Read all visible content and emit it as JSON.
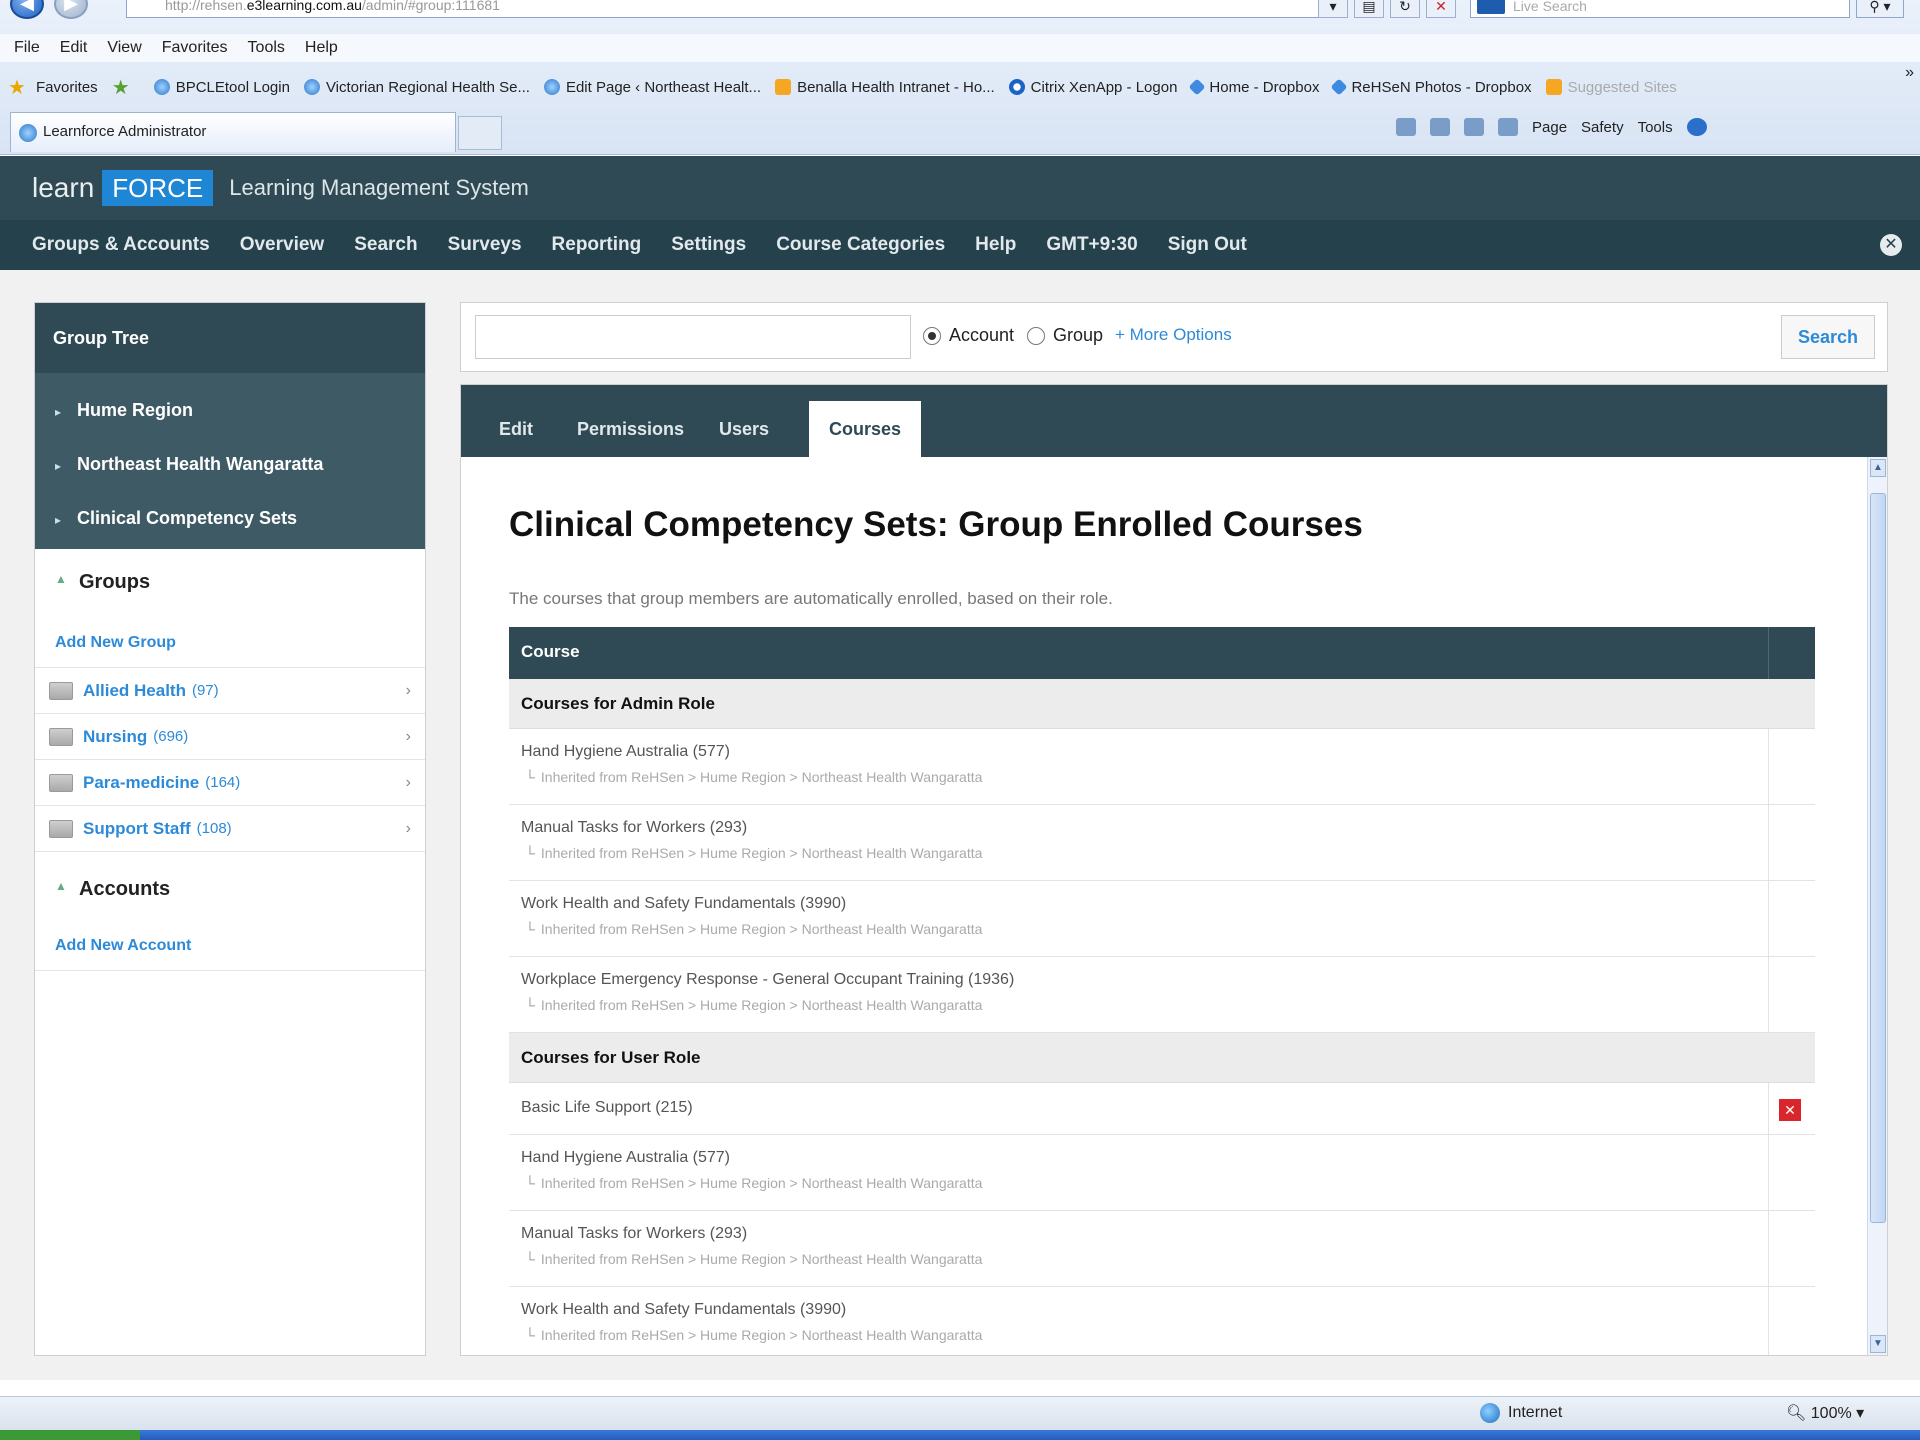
{
  "browser": {
    "url_prefix": "http://rehsen.",
    "url_domain": "e3learning.com.au",
    "url_path": "/admin/#group:111681",
    "live_search_placeholder": "Live Search",
    "menu": [
      "File",
      "Edit",
      "View",
      "Favorites",
      "Tools",
      "Help"
    ],
    "favorites_label": "Favorites",
    "favorites": [
      {
        "label": "BPCLEtool Login",
        "icon": "ie-icon"
      },
      {
        "label": "Victorian Regional Health Se...",
        "icon": "ie-icon"
      },
      {
        "label": "Edit Page ‹ Northeast Healt...",
        "icon": "ie-icon"
      },
      {
        "label": "Benalla Health Intranet - Ho...",
        "icon": "orange-icon"
      },
      {
        "label": "Citrix XenApp - Logon",
        "icon": "citrix-icon"
      },
      {
        "label": "Home - Dropbox",
        "icon": "dropbox-icon"
      },
      {
        "label": "ReHSeN Photos - Dropbox",
        "icon": "dropbox-icon"
      },
      {
        "label": "Suggested Sites",
        "icon": "orange-icon"
      }
    ],
    "tab_title": "Learnforce Administrator",
    "command_bar": [
      "Page",
      "Safety",
      "Tools"
    ],
    "status_zone": "Internet",
    "zoom": "100%"
  },
  "app": {
    "logo_learn": "learn",
    "logo_force": "FORCE",
    "logo_subtitle": "Learning Management System",
    "nav": [
      "Groups & Accounts",
      "Overview",
      "Search",
      "Surveys",
      "Reporting",
      "Settings",
      "Course Categories",
      "Help",
      "GMT+9:30",
      "Sign Out"
    ]
  },
  "sidebar": {
    "title": "Group Tree",
    "tree": [
      "Hume Region",
      "Northeast Health Wangaratta",
      "Clinical Competency Sets"
    ],
    "groups_heading": "Groups",
    "add_group": "Add New Group",
    "groups": [
      {
        "name": "Allied Health",
        "count": "(97)"
      },
      {
        "name": "Nursing",
        "count": "(696)"
      },
      {
        "name": "Para-medicine",
        "count": "(164)"
      },
      {
        "name": "Support Staff",
        "count": "(108)"
      }
    ],
    "accounts_heading": "Accounts",
    "add_account": "Add New Account"
  },
  "search": {
    "radio_account": "Account",
    "radio_group": "Group",
    "more_options": "+ More Options",
    "button": "Search"
  },
  "tabs": [
    "Edit",
    "Permissions",
    "Users",
    "Courses"
  ],
  "main": {
    "title": "Clinical Competency Sets: Group Enrolled Courses",
    "description": "The courses that group members are automatically enrolled, based on their role.",
    "column_header": "Course",
    "inherited_text": "Inherited from ReHSen > Hume Region > Northeast Health Wangaratta",
    "admin_heading": "Courses for Admin Role",
    "admin_courses": [
      "Hand Hygiene Australia (577)",
      "Manual Tasks for Workers (293)",
      "Work Health and Safety Fundamentals (3990)",
      "Workplace Emergency Response - General Occupant Training (1936)"
    ],
    "user_heading": "Courses for User Role",
    "user_direct_course": "Basic Life Support (215)",
    "user_courses": [
      "Hand Hygiene Australia (577)",
      "Manual Tasks for Workers (293)",
      "Work Health and Safety Fundamentals (3990)"
    ]
  }
}
